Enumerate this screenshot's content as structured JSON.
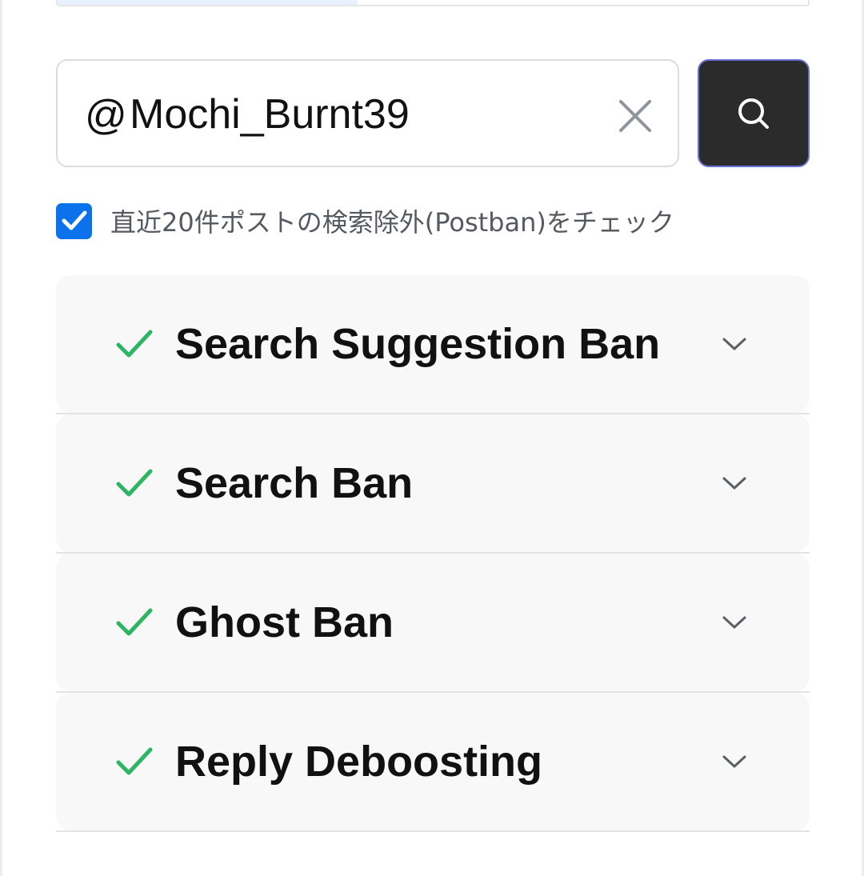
{
  "search": {
    "at_prefix": "@",
    "value": "Mochi_Burnt39",
    "clear_icon": "close-icon",
    "button_icon": "search-icon",
    "button_color": "#2b2b2b"
  },
  "tab_progress": {
    "fill_fraction": 0.4
  },
  "options": {
    "postban_checked": true,
    "postban_label": "直近20件ポストの検索除外(Postban)をチェック",
    "checkbox_color": "#0b72ec"
  },
  "results": [
    {
      "label": "Search Suggestion Ban",
      "status_icon": "check-icon",
      "status_color": "#2db564",
      "expand_icon": "chevron-down-icon"
    },
    {
      "label": "Search Ban",
      "status_icon": "check-icon",
      "status_color": "#2db564",
      "expand_icon": "chevron-down-icon"
    },
    {
      "label": "Ghost Ban",
      "status_icon": "check-icon",
      "status_color": "#2db564",
      "expand_icon": "chevron-down-icon"
    },
    {
      "label": "Reply Deboosting",
      "status_icon": "check-icon",
      "status_color": "#2db564",
      "expand_icon": "chevron-down-icon"
    }
  ]
}
